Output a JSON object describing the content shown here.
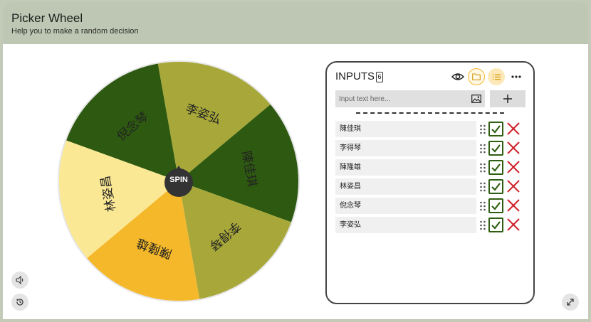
{
  "header": {
    "title": "Picker Wheel",
    "subtitle": "Help you to make a random decision"
  },
  "wheel": {
    "spin_label": "SPIN",
    "slices": [
      {
        "label": "倪念琴",
        "color": "#2d5a10",
        "text_color": "#ffffff"
      },
      {
        "label": "李姿弘",
        "color": "#a8a83a",
        "text_color": "#222222"
      },
      {
        "label": "陳佳琪",
        "color": "#2d5a10",
        "text_color": "#ffffff"
      },
      {
        "label": "李得琴",
        "color": "#a8a83a",
        "text_color": "#222222"
      },
      {
        "label": "陳隆雄",
        "color": "#f5b82a",
        "text_color": "#222222"
      },
      {
        "label": "林姿昌",
        "color": "#fbe894",
        "text_color": "#222222"
      }
    ]
  },
  "controls": {
    "sound_icon": "speaker-icon",
    "history_icon": "history-icon",
    "fullscreen_icon": "fullscreen-icon"
  },
  "panel": {
    "title": "INPUTS",
    "count": "6",
    "search_placeholder": "Input text here...",
    "entries": [
      {
        "label": "陳佳琪",
        "checked": true
      },
      {
        "label": "李得琴",
        "checked": true
      },
      {
        "label": "陳隆雄",
        "checked": true
      },
      {
        "label": "林姿昌",
        "checked": true
      },
      {
        "label": "倪念琴",
        "checked": true
      },
      {
        "label": "李姿弘",
        "checked": true
      }
    ]
  },
  "colors": {
    "accent": "#f5b82a",
    "check": "#2e5e12",
    "cross": "#d0222b",
    "header_bg": "#bdc7b3"
  }
}
